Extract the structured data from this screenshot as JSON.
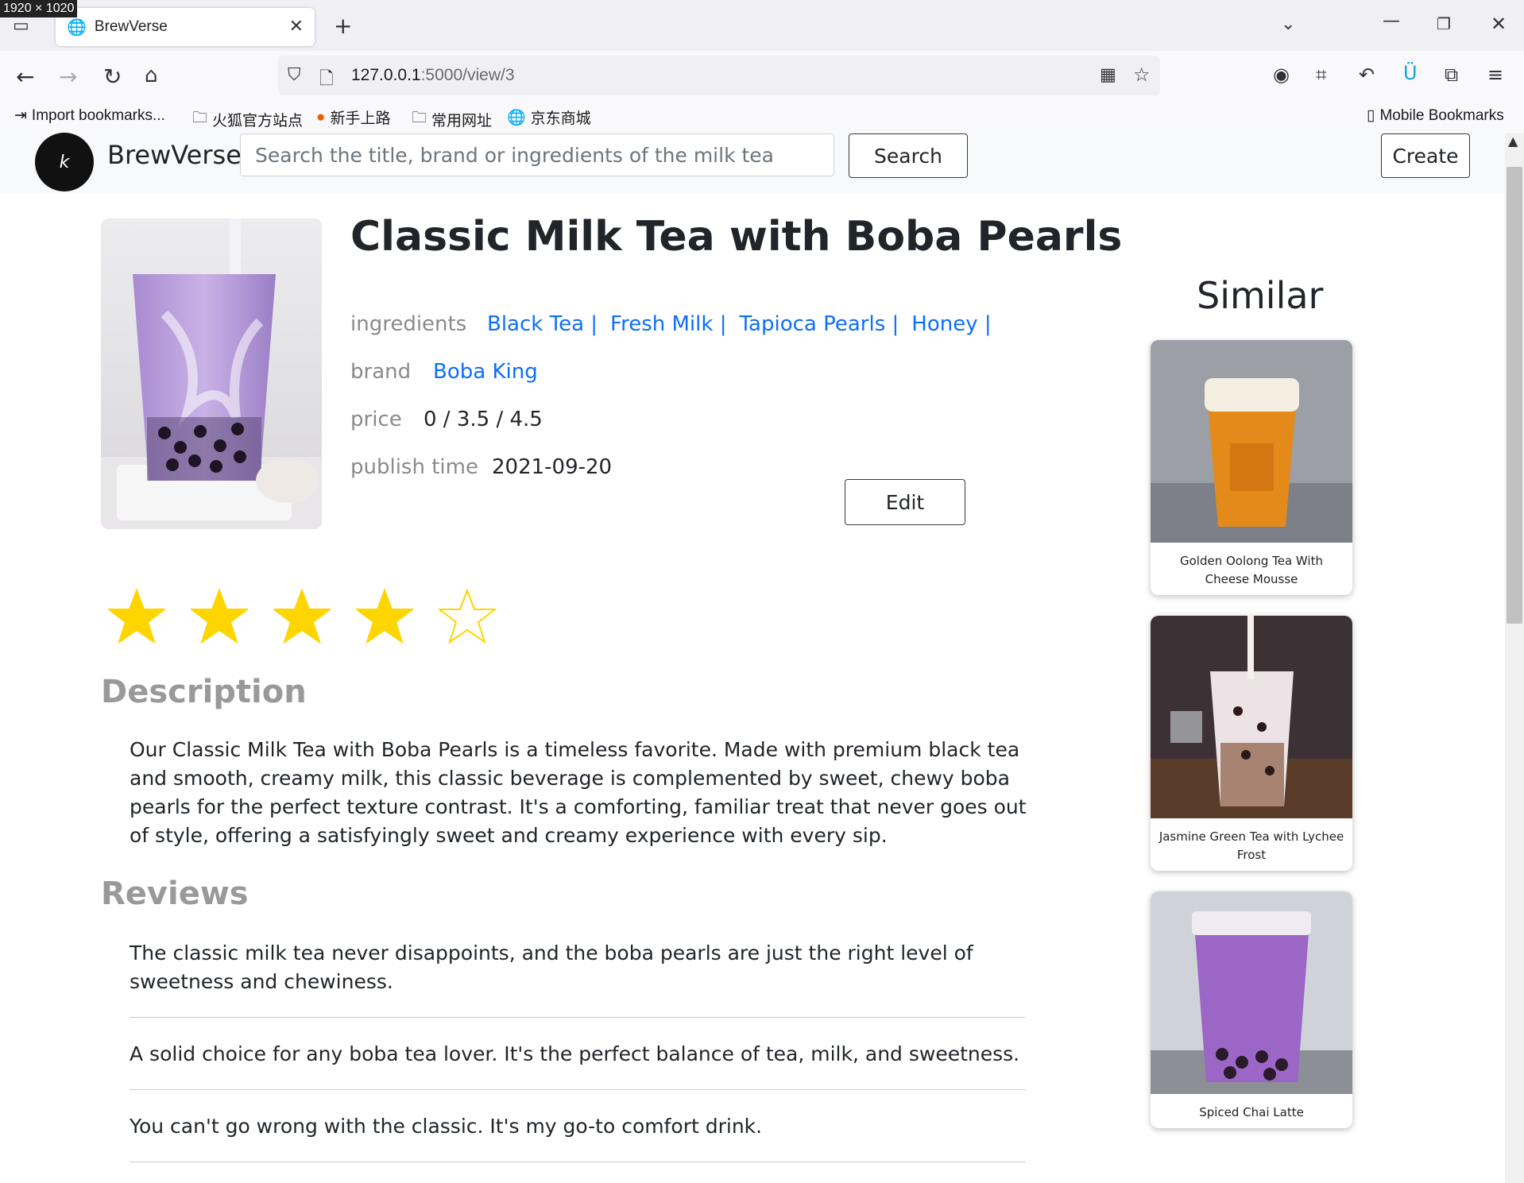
{
  "overlay": {
    "dimensions": "1920 × 1020"
  },
  "browser": {
    "tab_title": "BrewVerse",
    "url_host": "127.0.0.1",
    "url_rest": ":5000/view/3",
    "bookmarks": [
      "Import bookmarks...",
      "火狐官方站点",
      "新手上路",
      "常用网址",
      "京东商城"
    ],
    "mobile_bookmarks": "Mobile Bookmarks"
  },
  "header": {
    "brand": "BrewVerse",
    "logo_text": "k",
    "search_placeholder": "Search the title, brand or ingredients of the milk tea",
    "search_button": "Search",
    "create_button": "Create"
  },
  "product": {
    "title": "Classic Milk Tea with Boba Pearls",
    "ingredients_label": "ingredients",
    "ingredients": [
      "Black Tea |",
      "Fresh Milk |",
      "Tapioca Pearls |",
      "Honey |"
    ],
    "brand_label": "brand",
    "brand": "Boba King",
    "price_label": "price",
    "price": "0 / 3.5 / 4.5",
    "publish_label": "publish time",
    "publish_time": "2021-09-20",
    "edit_button": "Edit",
    "rating": 4,
    "rating_max": 5,
    "description_heading": "Description",
    "description": "Our Classic Milk Tea with Boba Pearls is a timeless favorite. Made with premium black tea and smooth, creamy milk, this classic beverage is complemented by sweet, chewy boba pearls for the perfect texture contrast. It's a comforting, familiar treat that never goes out of style, offering a satisfyingly sweet and creamy experience with every sip.",
    "reviews_heading": "Reviews",
    "reviews": [
      "The classic milk tea never disappoints, and the boba pearls are just the right level of sweetness and chewiness.",
      "A solid choice for any boba tea lover. It's the perfect balance of tea, milk, and sweetness.",
      "You can't go wrong with the classic. It's my go-to comfort drink."
    ]
  },
  "similar": {
    "heading": "Similar",
    "items": [
      {
        "name": "Golden Oolong Tea With Cheese Mousse"
      },
      {
        "name": "Jasmine Green Tea with Lychee Frost"
      },
      {
        "name": "Spiced Chai Latte"
      }
    ]
  },
  "colors": {
    "link": "#0d6efd",
    "star": "#ffd500",
    "muted": "#999999"
  }
}
